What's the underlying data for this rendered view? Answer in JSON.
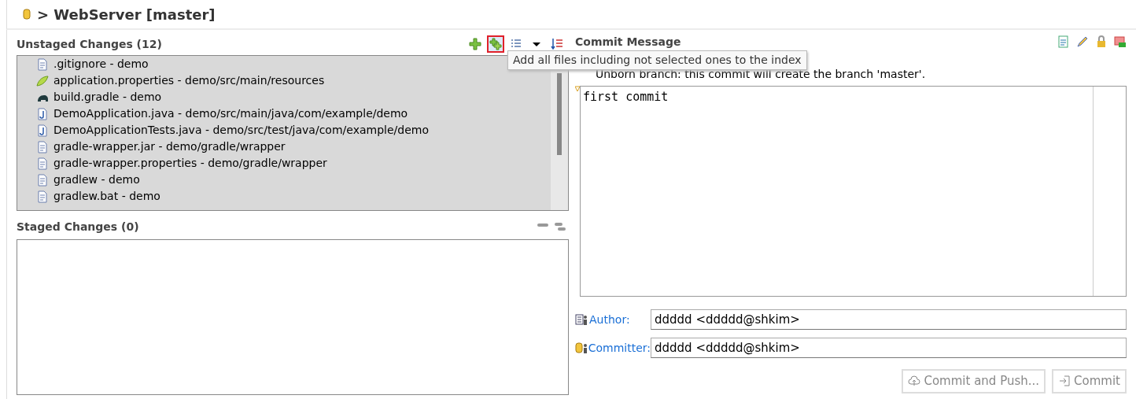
{
  "header": {
    "title": "> WebServer [master]"
  },
  "unstaged": {
    "title": "Unstaged Changes (12)",
    "toolbar": [
      {
        "kind": "add",
        "highlighted": false
      },
      {
        "kind": "add-all",
        "highlighted": true
      },
      {
        "kind": "list",
        "highlighted": false
      },
      {
        "kind": "dropdown",
        "highlighted": false
      },
      {
        "kind": "sort",
        "highlighted": false
      }
    ],
    "files": [
      {
        "kind": "text",
        "label": ".gitignore - demo"
      },
      {
        "kind": "properties",
        "label": "application.properties - demo/src/main/resources"
      },
      {
        "kind": "gradle",
        "label": "build.gradle - demo"
      },
      {
        "kind": "java",
        "label": "DemoApplication.java - demo/src/main/java/com/example/demo"
      },
      {
        "kind": "java",
        "label": "DemoApplicationTests.java - demo/src/test/java/com/example/demo"
      },
      {
        "kind": "text",
        "label": "gradle-wrapper.jar - demo/gradle/wrapper"
      },
      {
        "kind": "text",
        "label": "gradle-wrapper.properties - demo/gradle/wrapper"
      },
      {
        "kind": "text",
        "label": "gradlew - demo"
      },
      {
        "kind": "text",
        "label": "gradlew.bat - demo"
      }
    ]
  },
  "tooltip": "Add all files including not selected ones to the index",
  "staged": {
    "title": "Staged Changes (0)"
  },
  "commit": {
    "title": "Commit Message",
    "info": "Unborn branch: this commit will create the branch 'master'.",
    "message": "first commit",
    "author_label": "Author:",
    "author": "ddddd <ddddd@shkim>",
    "committer_label": "Committer:",
    "committer": "ddddd <ddddd@shkim>",
    "buttons": [
      {
        "kind": "push",
        "label": "Commit and Push...",
        "disabled": true
      },
      {
        "kind": "commit",
        "label": "Commit",
        "disabled": true
      }
    ]
  }
}
